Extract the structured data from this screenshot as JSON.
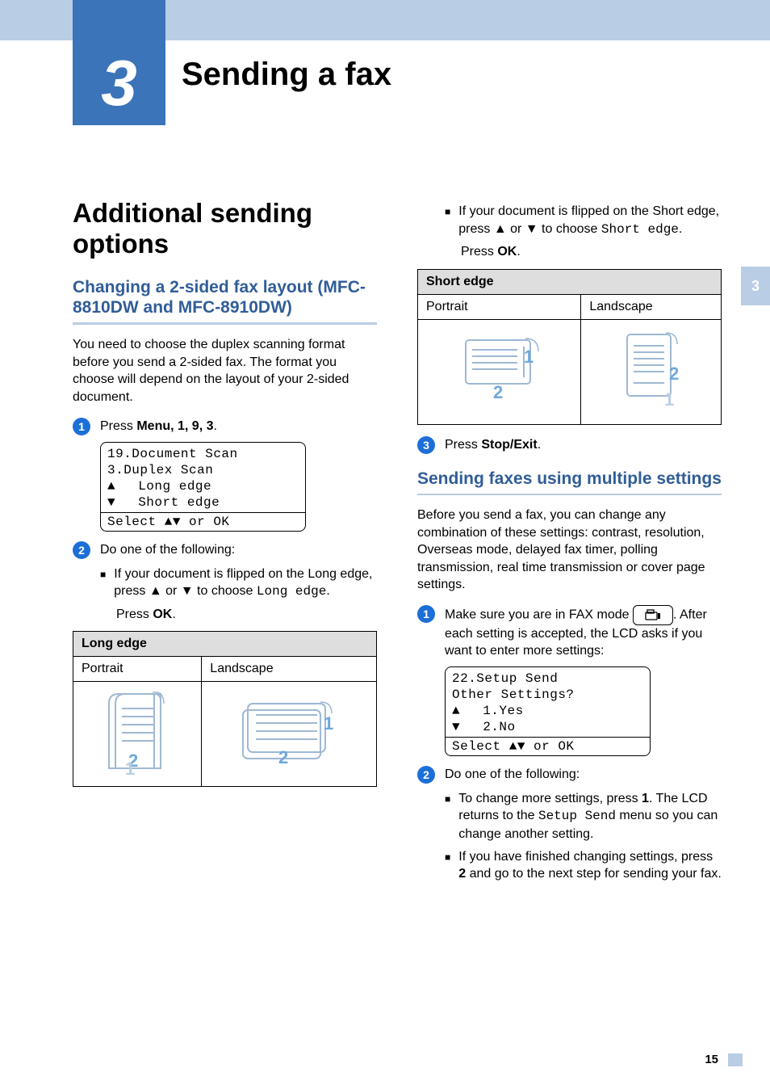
{
  "chapter": {
    "number": "3",
    "title": "Sending a fax",
    "tab": "3"
  },
  "sections": {
    "additional": "Additional sending options",
    "changing": "Changing a 2-sided fax layout (MFC-8810DW and MFC-8910DW)",
    "multiple": "Sending faxes using multiple settings"
  },
  "para": {
    "duplex_intro": "You need to choose the duplex scanning format before you send a 2-sided fax. The format you choose will depend on the layout of your 2-sided document.",
    "multiple_intro": "Before you send a fax, you can change any combination of these settings: contrast, resolution, Overseas mode, delayed fax timer, polling transmission, real time transmission or cover page settings."
  },
  "steps": {
    "s1_pre": "Press ",
    "s1_menu": "Menu",
    "s1_seq": ", 1, 9, 3.",
    "s2": "Do one of the following:",
    "long_a": "If your document is flipped on the Long edge, press ▲ or ▼ to choose ",
    "long_code": "Long edge",
    "press_ok_pre": "Press ",
    "press_ok": "OK",
    "short_a": "If your document is flipped on the Short edge, press ▲ or ▼ to choose ",
    "short_code": "Short edge",
    "s3_pre": "Press ",
    "s3_btn": "Stop/Exit",
    "m1_a": "Make sure you are in FAX mode ",
    "m1_b": ". After each setting is accepted, the LCD asks if you want to enter more settings:",
    "m2": "Do one of the following:",
    "m2_b1_a": "To change more settings, press ",
    "m2_b1_key": "1",
    "m2_b1_b": ". The LCD returns to the ",
    "m2_b1_code": "Setup Send",
    "m2_b1_c": " menu so you can change another setting.",
    "m2_b2_a": "If you have finished changing settings, press ",
    "m2_b2_key": "2",
    "m2_b2_b": " and go to the next step for sending your fax."
  },
  "lcd1": {
    "l1": "19.Document Scan",
    "l2": "  3.Duplex Scan",
    "l3": "Long edge",
    "l4": "Short edge",
    "l5": "Select ▲▼ or OK"
  },
  "lcd2": {
    "l1": "22.Setup Send",
    "l2": "  Other Settings?",
    "l3": "1.Yes",
    "l4": "2.No",
    "l5": "Select ▲▼ or OK"
  },
  "tables": {
    "long_hdr": "Long edge",
    "short_hdr": "Short edge",
    "portrait": "Portrait",
    "landscape": "Landscape"
  },
  "page_number": "15"
}
